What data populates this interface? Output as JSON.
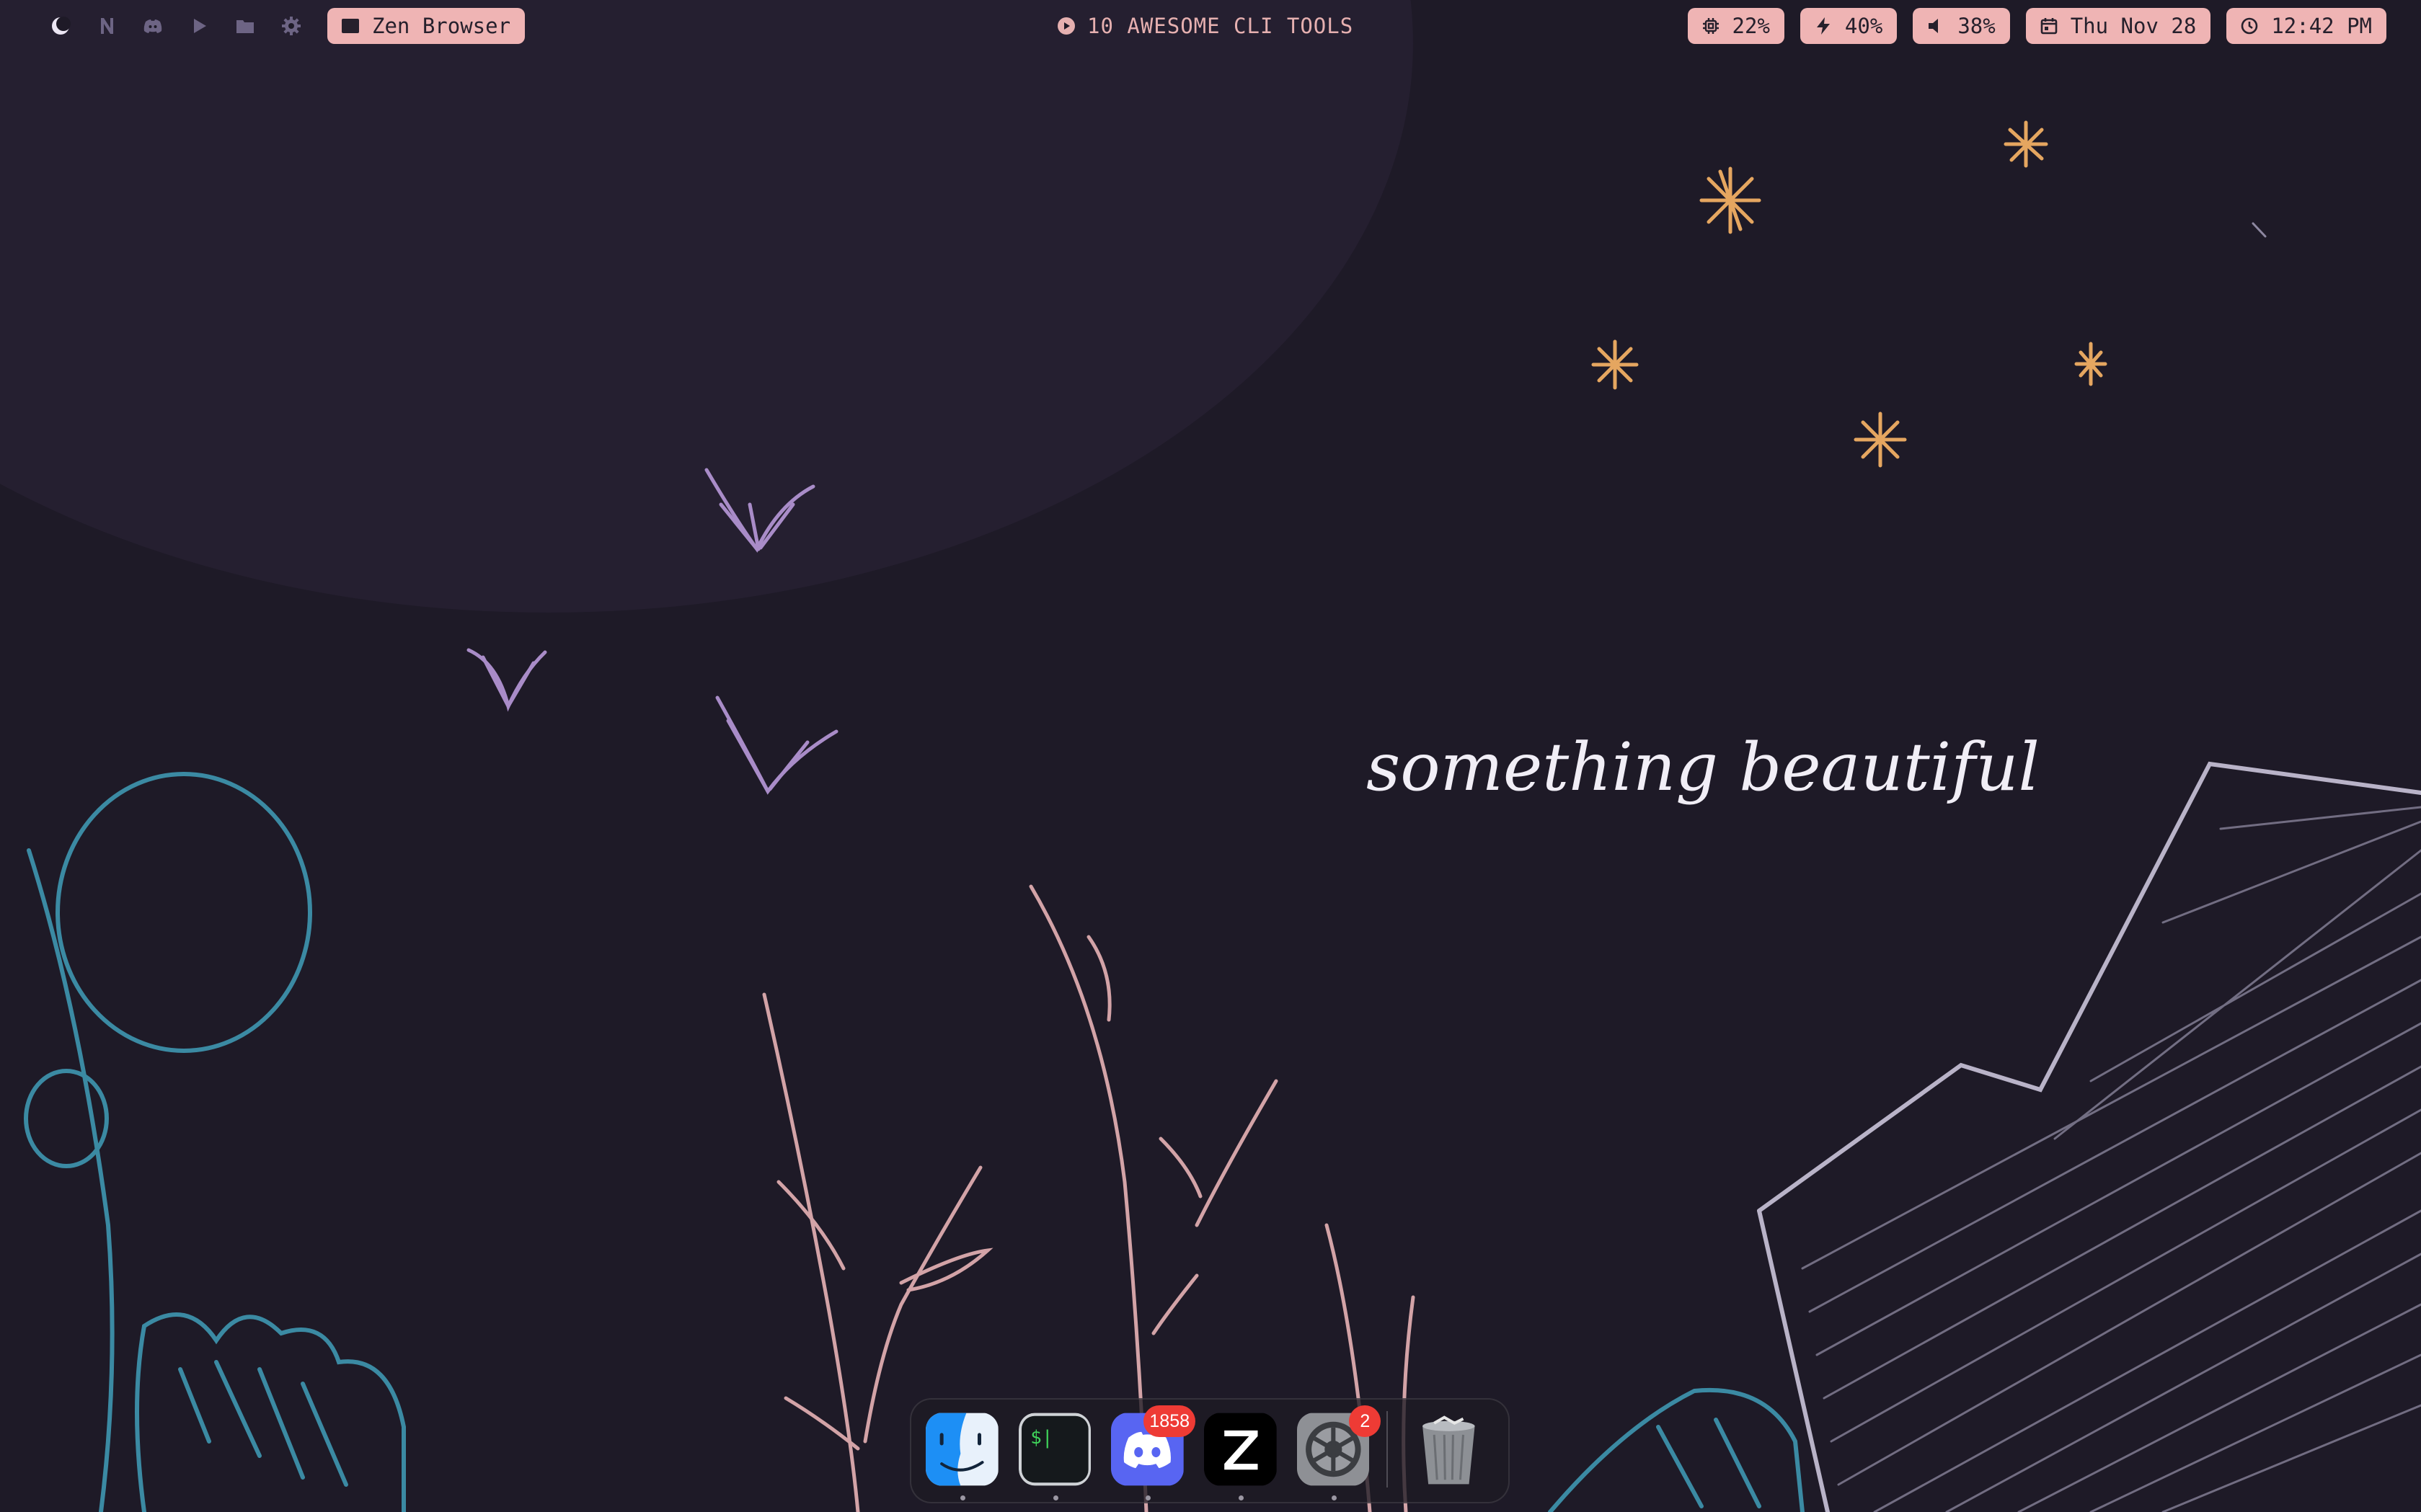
{
  "menubar": {
    "workspace_icons": [
      {
        "name": "moon-icon"
      },
      {
        "name": "notion-icon"
      },
      {
        "name": "discord-icon"
      },
      {
        "name": "play-icon"
      },
      {
        "name": "folder-icon"
      },
      {
        "name": "gear-icon"
      }
    ],
    "active_app": {
      "label": "Zen Browser",
      "icon": "terminal-window-icon"
    },
    "media": {
      "label": "10 AWESOME CLI TOOLS",
      "icon": "record-icon"
    },
    "status": {
      "cpu": {
        "label": "22%",
        "icon": "cpu-icon"
      },
      "battery": {
        "label": "40%",
        "icon": "bolt-icon"
      },
      "volume": {
        "label": "38%",
        "icon": "speaker-icon"
      },
      "date": {
        "label": "Thu Nov 28",
        "icon": "calendar-icon"
      },
      "time": {
        "label": "12:42 PM",
        "icon": "clock-icon"
      }
    }
  },
  "dock": {
    "apps": [
      {
        "name": "finder",
        "running": true,
        "badge": ""
      },
      {
        "name": "terminal",
        "running": true,
        "badge": ""
      },
      {
        "name": "discord",
        "running": true,
        "badge": "1858"
      },
      {
        "name": "zed",
        "running": true,
        "badge": ""
      },
      {
        "name": "system-settings",
        "running": true,
        "badge": "2"
      },
      {
        "name": "trash",
        "running": false,
        "badge": ""
      }
    ],
    "terminal_prompt": "$|"
  },
  "wallpaper": {
    "caption": "something beautiful",
    "colors": {
      "background": "#1e1a27",
      "moon": "#251f30",
      "stars": "#e5a660",
      "birds": "#a98cc8",
      "plants": "#d3a3a7",
      "blue_lines": "#3b8aa3",
      "house": "#b9b3c8",
      "heart": "#ec6d9c",
      "accent_pill": "#efb4b4"
    }
  }
}
